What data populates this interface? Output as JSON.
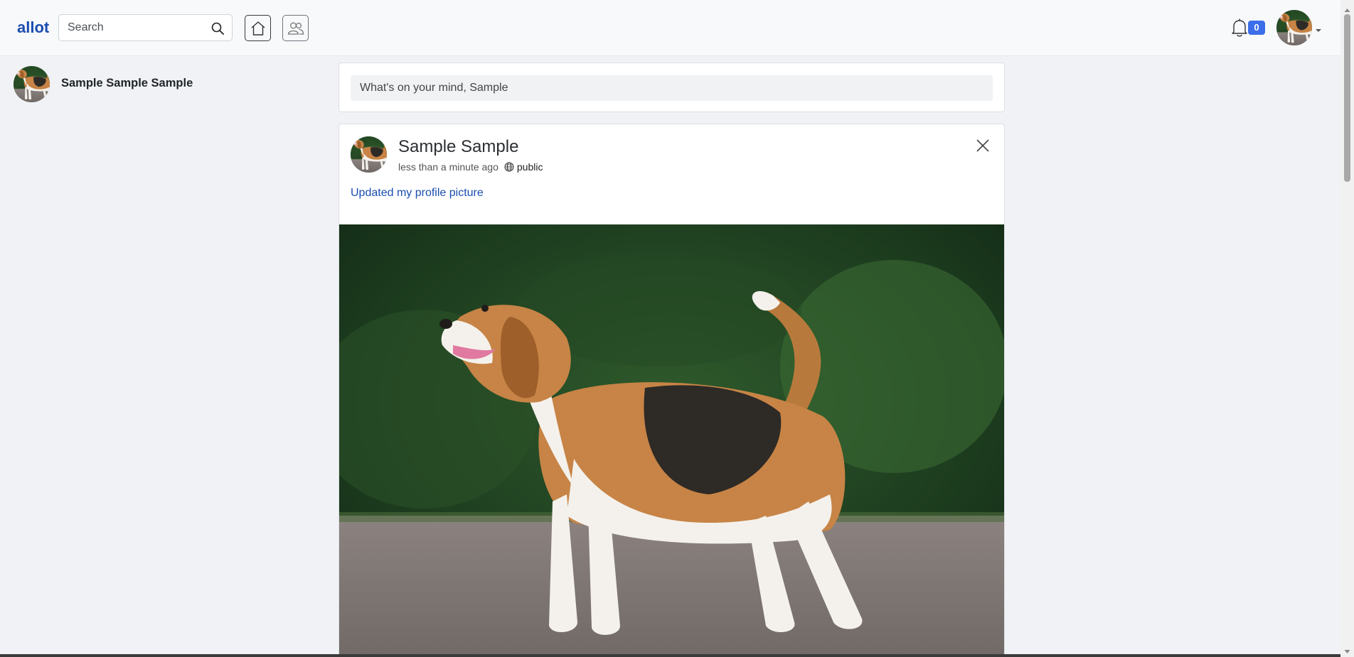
{
  "navbar": {
    "brand": "allot",
    "search_placeholder": "Search",
    "notification_count": "0",
    "icons": {
      "search": "search-icon",
      "home": "house-icon",
      "friends": "people-icon",
      "notifications": "bell-icon",
      "caret": "caret-down-icon"
    }
  },
  "sidebar": {
    "user_name": "Sample Sample Sample"
  },
  "composer": {
    "placeholder": "What's on your mind, Sample"
  },
  "post": {
    "author": "Sample Sample",
    "time": "less than a minute ago",
    "visibility": "public",
    "text": "Updated my profile picture",
    "image": "beagle-photo"
  },
  "colors": {
    "brand": "#1a4db0",
    "badge": "#3b6ee8",
    "page_bg": "#f0f2f5"
  }
}
